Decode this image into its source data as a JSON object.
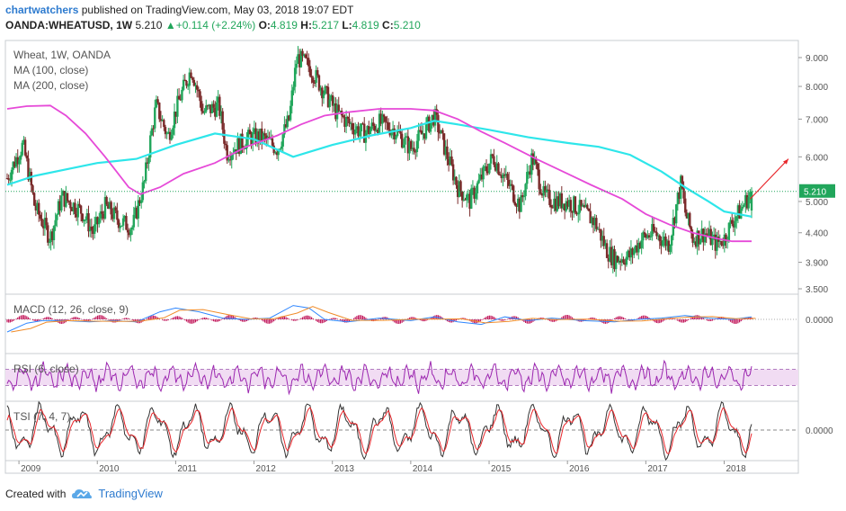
{
  "header": {
    "author": "chartwatchers",
    "published_text": "published on TradingView.com, May 03, 2018 19:07 EDT",
    "symbol": "OANDA:WHEATUSD, 1W",
    "last": "5.210",
    "change": "+0.114 (+2.24%)",
    "o_label": "O:",
    "o": "4.819",
    "h_label": "H:",
    "h": "5.217",
    "l_label": "L:",
    "l": "4.819",
    "c_label": "C:",
    "c": "5.210"
  },
  "legend": {
    "title": "Wheat, 1W, OANDA",
    "ma100": "MA (100, close)",
    "ma200": "MA (200, close)",
    "macd": "MACD (12, 26, close, 9)",
    "rsi": "RSI (6, close)",
    "tsi": "TSI (7, 4, 7)"
  },
  "footer": {
    "created_with": "Created with",
    "brand": "TradingView"
  },
  "colors": {
    "up": "#21a65b",
    "down": "#7a2a2a",
    "ma100": "#2ee6ea",
    "ma200": "#e64ad8",
    "price_line": "#21a65b",
    "price_label_bg": "#21a65b",
    "arrow": "#e8262b",
    "macd": "#2e86ff",
    "signal": "#f08c2a",
    "hist": "#c2185b",
    "rsi": "#9c27b0",
    "rsi_band": "#f1dcf3",
    "tsi": "#333333",
    "tsi_signal": "#e8262b"
  },
  "chart_data": [
    {
      "type": "candlestick",
      "title": "Wheat, 1W, OANDA",
      "xlabel": "",
      "ylabel": "",
      "x_ticks": [
        "2009",
        "2010",
        "2011",
        "2012",
        "2013",
        "2014",
        "2015",
        "2016",
        "2017",
        "2018"
      ],
      "y_ticks": [
        "9.000",
        "8.000",
        "7.000",
        "6.000",
        "5.000",
        "4.400",
        "3.900",
        "3.500"
      ],
      "ylim": [
        3.5,
        9.3
      ],
      "scale": "log",
      "last_price_label": "5.210",
      "price_path": {
        "dates": [
          2008.85,
          2009.05,
          2009.2,
          2009.4,
          2009.55,
          2009.8,
          2009.95,
          2010.1,
          2010.3,
          2010.45,
          2010.6,
          2010.75,
          2010.9,
          2011.05,
          2011.2,
          2011.35,
          2011.55,
          2011.65,
          2011.8,
          2011.95,
          2012.1,
          2012.3,
          2012.45,
          2012.55,
          2012.7,
          2012.9,
          2013.05,
          2013.2,
          2013.4,
          2013.6,
          2013.8,
          2014.0,
          2014.15,
          2014.3,
          2014.45,
          2014.6,
          2014.75,
          2014.9,
          2015.05,
          2015.2,
          2015.4,
          2015.55,
          2015.7,
          2015.85,
          2016.0,
          2016.2,
          2016.35,
          2016.5,
          2016.6,
          2016.8,
          2016.95,
          2017.1,
          2017.3,
          2017.45,
          2017.5,
          2017.6,
          2017.75,
          2017.9,
          2018.0,
          2018.1,
          2018.2,
          2018.35
        ],
        "closes": [
          5.5,
          6.3,
          4.9,
          4.3,
          5.1,
          4.8,
          4.4,
          4.9,
          4.6,
          4.5,
          5.4,
          7.4,
          6.5,
          7.6,
          8.6,
          7.2,
          7.4,
          6.1,
          6.3,
          6.5,
          6.5,
          6.2,
          7.0,
          9.0,
          8.7,
          7.8,
          7.2,
          6.9,
          6.6,
          6.9,
          6.7,
          6.2,
          6.6,
          7.1,
          6.1,
          5.3,
          5.0,
          5.5,
          6.0,
          5.5,
          4.9,
          6.0,
          5.1,
          5.0,
          5.0,
          4.8,
          4.6,
          4.1,
          3.95,
          4.0,
          4.3,
          4.4,
          4.2,
          5.4,
          4.8,
          4.3,
          4.4,
          4.2,
          4.3,
          4.6,
          4.8,
          5.21
        ]
      },
      "ma100_path": {
        "dates": [
          2008.85,
          2009.2,
          2009.6,
          2010.0,
          2010.5,
          2011.0,
          2011.5,
          2012.0,
          2012.5,
          2013.0,
          2013.5,
          2014.0,
          2014.3,
          2014.6,
          2015.0,
          2015.5,
          2016.0,
          2016.4,
          2016.8,
          2017.2,
          2017.5,
          2017.8,
          2018.0,
          2018.35
        ],
        "values": [
          5.35,
          5.55,
          5.7,
          5.85,
          5.95,
          6.3,
          6.6,
          6.45,
          6.0,
          6.3,
          6.55,
          6.75,
          6.95,
          6.85,
          6.7,
          6.5,
          6.35,
          6.25,
          6.05,
          5.65,
          5.3,
          5.0,
          4.8,
          4.7
        ]
      },
      "ma200_path": {
        "dates": [
          2008.85,
          2009.1,
          2009.4,
          2009.6,
          2009.85,
          2010.1,
          2010.4,
          2010.55,
          2010.8,
          2011.1,
          2011.5,
          2011.9,
          2012.3,
          2012.6,
          2012.9,
          2013.2,
          2013.6,
          2014.0,
          2014.3,
          2014.6,
          2014.9,
          2015.2,
          2015.6,
          2016.0,
          2016.3,
          2016.7,
          2017.0,
          2017.3,
          2017.6,
          2017.9,
          2018.1,
          2018.35
        ],
        "values": [
          7.3,
          7.38,
          7.4,
          7.1,
          6.6,
          6.0,
          5.3,
          5.15,
          5.3,
          5.6,
          5.85,
          6.25,
          6.55,
          6.85,
          7.1,
          7.2,
          7.3,
          7.3,
          7.25,
          7.0,
          6.65,
          6.35,
          5.95,
          5.6,
          5.35,
          5.05,
          4.75,
          4.55,
          4.4,
          4.3,
          4.25,
          4.25
        ]
      }
    },
    {
      "type": "line",
      "title": "MACD (12, 26, close, 9)",
      "y_ticks": [
        "0.0000"
      ],
      "series": [
        {
          "name": "MACD",
          "x": [
            2008.85,
            2009.1,
            2009.3,
            2009.6,
            2009.9,
            2010.2,
            2010.5,
            2010.8,
            2011.0,
            2011.3,
            2011.6,
            2011.9,
            2012.2,
            2012.5,
            2012.7,
            2012.9,
            2013.2,
            2013.6,
            2014.0,
            2014.3,
            2014.6,
            2014.9,
            2015.2,
            2015.5,
            2015.8,
            2016.2,
            2016.6,
            2016.9,
            2017.2,
            2017.5,
            2017.8,
            2018.1,
            2018.35
          ],
          "values": [
            -0.5,
            -0.15,
            -0.05,
            -0.05,
            -0.1,
            -0.05,
            -0.1,
            0.3,
            0.45,
            0.3,
            0.05,
            0.0,
            0.05,
            0.55,
            0.45,
            0.0,
            -0.1,
            0.05,
            -0.05,
            0.1,
            -0.1,
            -0.2,
            0.1,
            -0.05,
            0.05,
            -0.05,
            -0.1,
            0.0,
            0.05,
            0.15,
            0.05,
            0.0,
            0.1
          ]
        }
      ]
    },
    {
      "type": "line",
      "title": "RSI (6, close)",
      "ylim": [
        0,
        100
      ],
      "band": [
        30,
        70
      ]
    },
    {
      "type": "line",
      "title": "TSI (7, 4, 7)",
      "y_ticks": [
        "0.0000"
      ]
    }
  ]
}
